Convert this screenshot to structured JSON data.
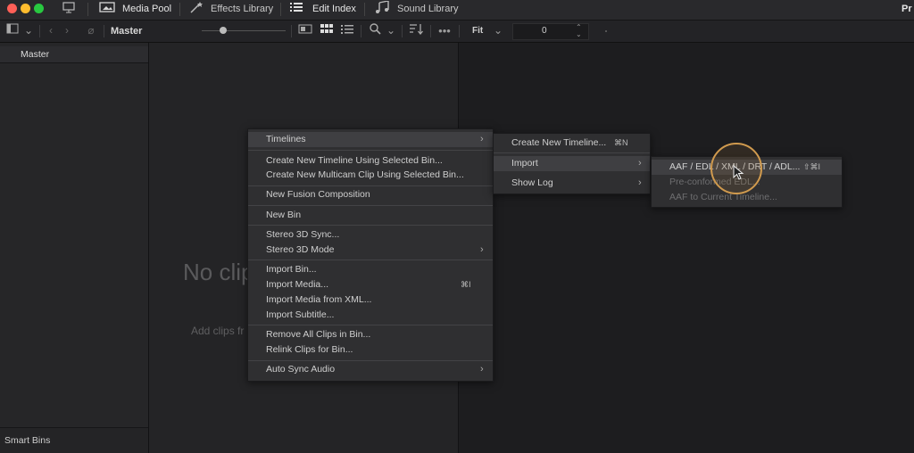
{
  "topbar": {
    "media_pool": "Media Pool",
    "effects_library": "Effects Library",
    "edit_index": "Edit Index",
    "sound_library": "Sound Library",
    "right_text": "Pr"
  },
  "toolbar": {
    "bin_name": "Master",
    "zoom_mode": "Fit",
    "timecode": "0"
  },
  "sidebar": {
    "master": "Master",
    "smart_bins": "Smart Bins"
  },
  "pool": {
    "empty_title": "No clip",
    "empty_hint": "Add clips fr"
  },
  "context_menu": {
    "items": [
      {
        "label": "Timelines",
        "submenu": true
      },
      {
        "label": "Create New Timeline Using Selected Bin..."
      },
      {
        "label": "Create New Multicam Clip Using Selected Bin..."
      },
      {
        "label": "New Fusion Composition"
      },
      {
        "label": "New Bin"
      },
      {
        "label": "Stereo 3D Sync..."
      },
      {
        "label": "Stereo 3D Mode",
        "submenu": true
      },
      {
        "label": "Import Bin..."
      },
      {
        "label": "Import Media...",
        "shortcut": "⌘I"
      },
      {
        "label": "Import Media from XML..."
      },
      {
        "label": "Import Subtitle..."
      },
      {
        "label": "Remove All Clips in Bin..."
      },
      {
        "label": "Relink Clips for Bin..."
      },
      {
        "label": "Auto Sync Audio",
        "submenu": true
      }
    ]
  },
  "timelines_submenu": {
    "items": [
      {
        "label": "Create New Timeline...",
        "shortcut": "⌘N"
      },
      {
        "label": "Import",
        "submenu": true
      },
      {
        "label": "Show Log",
        "submenu": true
      }
    ]
  },
  "import_submenu": {
    "items": [
      {
        "label": "AAF / EDL / XML / DRT / ADL...",
        "shortcut": "⇧⌘I"
      },
      {
        "label": "Pre-conformed EDL..."
      },
      {
        "label": "AAF to Current Timeline..."
      }
    ]
  },
  "icons": [
    "media-pool-icon",
    "effects-library-icon",
    "edit-index-icon",
    "sound-library-icon",
    "sidebar-toggle-icon",
    "back-icon",
    "forward-icon",
    "link-icon",
    "thumbnail-view-icon",
    "grid-view-icon",
    "list-view-icon",
    "search-icon",
    "sort-icon",
    "more-options-icon",
    "chevron-down-icon",
    "stepper-icon"
  ],
  "colors": {
    "highlight": "#3f3f42",
    "cursor_ring": "#d09a4e"
  }
}
